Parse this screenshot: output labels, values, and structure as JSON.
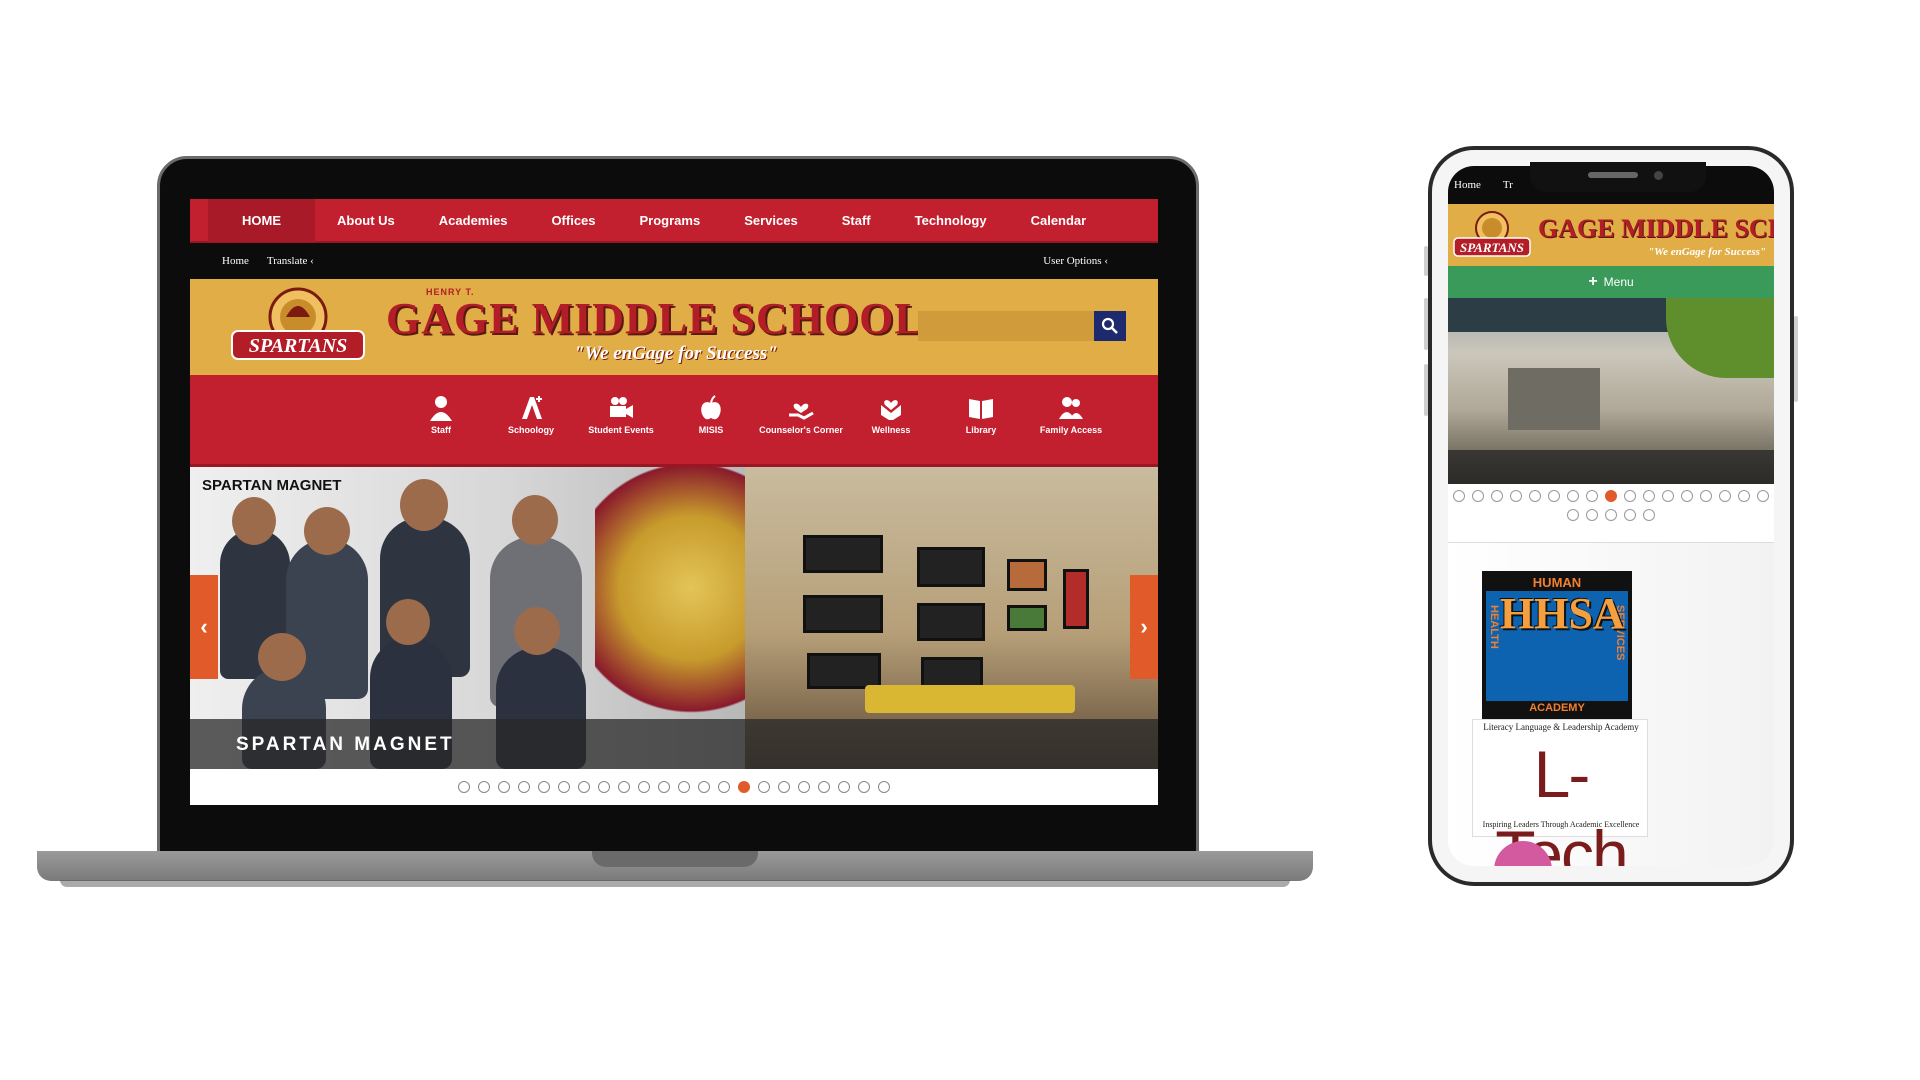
{
  "laptop": {
    "topnav": [
      "HOME",
      "About Us",
      "Academies",
      "Offices",
      "Programs",
      "Services",
      "Staff",
      "Technology",
      "Calendar"
    ],
    "utility": {
      "home": "Home",
      "translate": "Translate ‹",
      "user_options": "User Options ‹"
    },
    "header": {
      "prefix": "HENRY T.",
      "title": "GAGE MIDDLE SCHOOL",
      "tagline": "\"We enGage for Success\"",
      "logo_text": "SPARTANS"
    },
    "quicklinks": [
      "Staff",
      "Schoology",
      "Student Events",
      "MISIS",
      "Counselor's Corner",
      "Wellness",
      "Library",
      "Family Access"
    ],
    "hero": {
      "label": "SPARTAN MAGNET",
      "caption": "SPARTAN MAGNET",
      "prev": "‹",
      "next": "›"
    },
    "slider": {
      "count": 22,
      "active_index": 14
    },
    "colors": {
      "brand_red": "#c2202f",
      "brand_gold": "#e1ad46",
      "accent_orange": "#e05a2a",
      "search_blue": "#1d2a6e"
    }
  },
  "phone": {
    "utility": {
      "home": "Home",
      "translate": "Tr"
    },
    "header": {
      "title": "GAGE MIDDLE SCHOOL",
      "tagline": "\"We enGage for Success\"",
      "logo_text": "SPARTANS"
    },
    "menu_label": "Menu",
    "slider": {
      "count": 22,
      "active_index": 8
    },
    "hhsa": {
      "top": "HUMAN",
      "main": "HHSA",
      "left": "HEALTH",
      "right": "SERVICES",
      "bottom": "ACADEMY"
    },
    "ltech": {
      "top": "Literacy Language & Leadership Academy",
      "main": "L-Tech",
      "bottom": "Inspiring Leaders Through Academic Excellence"
    },
    "colors": {
      "menu_green": "#3a9a5a"
    }
  }
}
